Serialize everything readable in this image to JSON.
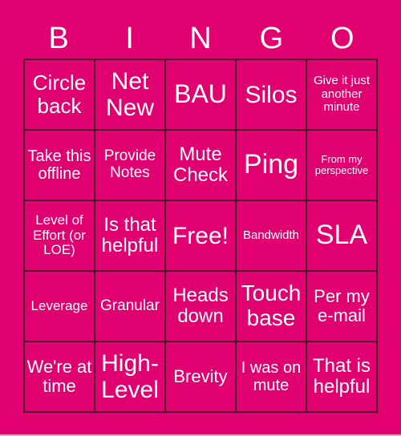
{
  "header": {
    "letters": [
      "B",
      "I",
      "N",
      "G",
      "O"
    ]
  },
  "board": {
    "rows": [
      [
        "Circle back",
        "Net New",
        "BAU",
        "Silos",
        "Give it just another minute"
      ],
      [
        "Take this offline",
        "Provide Notes",
        "Mute Check",
        "Ping",
        "From my perspective"
      ],
      [
        "Level of Effort (or LOE)",
        "Is that helpful",
        "Free!",
        "Bandwidth",
        "SLA"
      ],
      [
        "Leverage",
        "Granular",
        "Heads down",
        "Touch base",
        "Per my e-mail"
      ],
      [
        "We're at time",
        "High-Level",
        "Brevity",
        "I was on mute",
        "That is helpful"
      ]
    ]
  },
  "colors": {
    "background": "#e0006f",
    "text": "#ffffff",
    "grid_line": "#4a0a2a"
  }
}
